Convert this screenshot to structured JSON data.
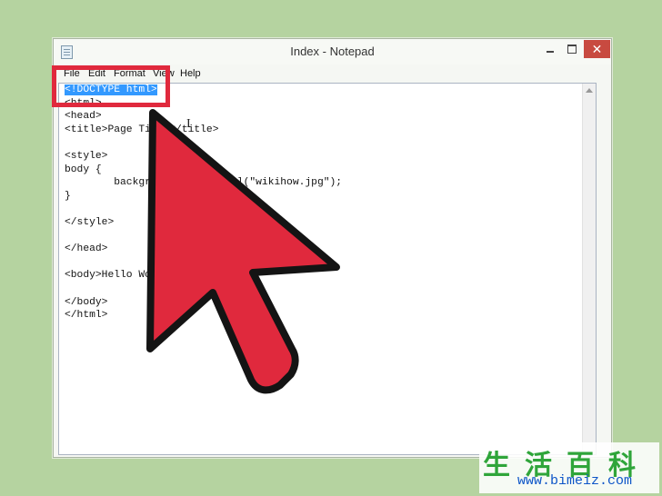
{
  "window": {
    "title": "Index - Notepad",
    "controls": {
      "minimize": "",
      "maximize": "",
      "close": "✕"
    }
  },
  "menu": {
    "file": "File",
    "edit": "Edit",
    "format": "Format",
    "view": "View",
    "help": "Help"
  },
  "editor": {
    "selected_text": "<!DOCTYPE html>",
    "rest_text": "\n<html>\n<head>\n<title>Page Title</title>\n\n<style>\nbody {\n        background-image: url(\"wikihow.jpg\");\n}\n\n</style>\n\n</head>\n\n<body>Hello World</body>\n\n</body>\n</html>"
  },
  "overlay": {
    "highlight_color": "#e0293d",
    "arrow_color": "#e0293d"
  },
  "watermark": {
    "chars": "生活百科",
    "url": "www.bimeiz.com"
  }
}
